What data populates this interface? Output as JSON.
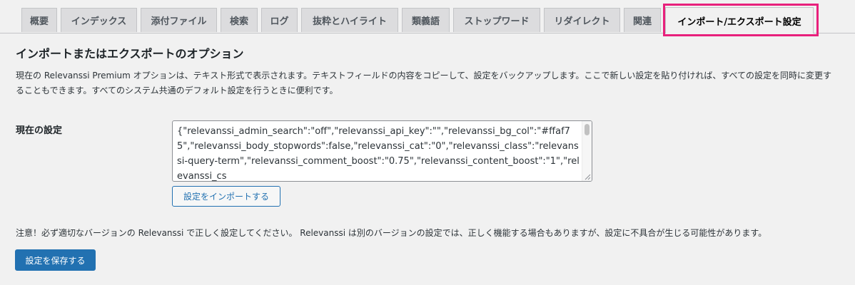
{
  "tabs": [
    {
      "label": "概要",
      "active": false
    },
    {
      "label": "インデックス",
      "active": false
    },
    {
      "label": "添付ファイル",
      "active": false
    },
    {
      "label": "検索",
      "active": false
    },
    {
      "label": "ログ",
      "active": false
    },
    {
      "label": "抜粋とハイライト",
      "active": false
    },
    {
      "label": "類義語",
      "active": false
    },
    {
      "label": "ストップワード",
      "active": false
    },
    {
      "label": "リダイレクト",
      "active": false
    },
    {
      "label": "関連",
      "active": false
    },
    {
      "label": "インポート/エクスポート設定",
      "active": true
    }
  ],
  "section": {
    "title": "インポートまたはエクスポートのオプション",
    "description": "現在の Relevanssi Premium オプションは、テキスト形式で表示されます。テキストフィールドの内容をコピーして、設定をバックアップします。ここで新しい設定を貼り付ければ、すべての設定を同時に変更することもできます。すべてのシステム共通のデフォルト設定を行うときに便利です。"
  },
  "current_settings": {
    "label": "現在の設定",
    "value": "{\"relevanssi_admin_search\":\"off\",\"relevanssi_api_key\":\"\",\"relevanssi_bg_col\":\"#ffaf75\",\"relevanssi_body_stopwords\":false,\"relevanssi_cat\":\"0\",\"relevanssi_class\":\"relevanssi-query-term\",\"relevanssi_comment_boost\":\"0.75\",\"relevanssi_content_boost\":\"1\",\"relevanssi_cs"
  },
  "buttons": {
    "import_label": "設定をインポートする",
    "save_label": "設定を保存する"
  },
  "notice": "注意！必ず適切なバージョンの Relevanssi で正しく設定してください。 Relevanssi は別のバージョンの設定では、正しく機能する場合もありますが、設定に不具合が生じる可能性があります。",
  "colors": {
    "highlight_border": "#e8207c",
    "primary_button": "#2271b1"
  }
}
